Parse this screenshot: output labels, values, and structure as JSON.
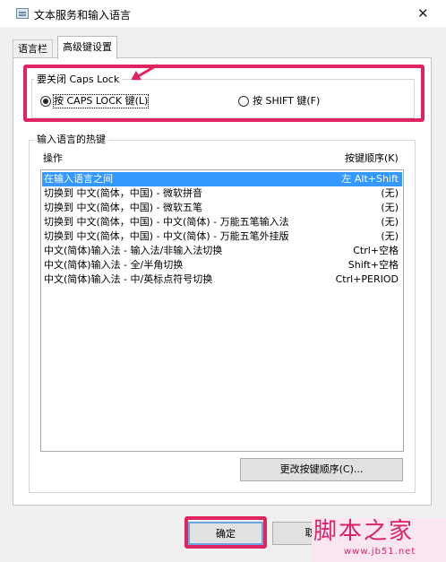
{
  "window": {
    "title": "文本服务和输入语言",
    "close_glyph": "✕"
  },
  "tabs": [
    {
      "label": "语言栏"
    },
    {
      "label": "高级键设置",
      "active": true
    }
  ],
  "caps_lock": {
    "group_label": "要关闭 Caps Lock",
    "options": [
      {
        "label": "按 CAPS LOCK 键(L)",
        "selected": true
      },
      {
        "label": "按 SHIFT 键(F)",
        "selected": false
      }
    ]
  },
  "hotkeys": {
    "group_label": "输入语言的热键",
    "columns": {
      "action": "操作",
      "sequence": "按键顺序(K)"
    },
    "rows": [
      {
        "action": "在输入语言之间",
        "keys": "左 Alt+Shift",
        "selected": true
      },
      {
        "action": "切换到 中文(简体，中国) - 微软拼音",
        "keys": "(无)"
      },
      {
        "action": "切换到 中文(简体，中国) - 微软五笔",
        "keys": "(无)"
      },
      {
        "action": "切换到 中文(简体，中国) - 中文(简体) - 万能五笔输入法",
        "keys": "(无)"
      },
      {
        "action": "切换到 中文(简体，中国) - 中文(简体) - 万能五笔外挂版",
        "keys": "(无)"
      },
      {
        "action": "中文(简体)输入法 - 输入法/非输入法切换",
        "keys": "Ctrl+空格"
      },
      {
        "action": "中文(简体)输入法 - 全/半角切换",
        "keys": "Shift+空格"
      },
      {
        "action": "中文(简体)输入法 - 中/英标点符号切换",
        "keys": "Ctrl+PERIOD"
      }
    ]
  },
  "buttons": {
    "change_sequence": "更改按键顺序(C)...",
    "ok": "确定",
    "cancel": "取"
  },
  "watermark": {
    "text": "脚本之家",
    "url": "www.jb51.net"
  },
  "colors": {
    "annotation": "#e0245f",
    "selection": "#3399ff"
  }
}
